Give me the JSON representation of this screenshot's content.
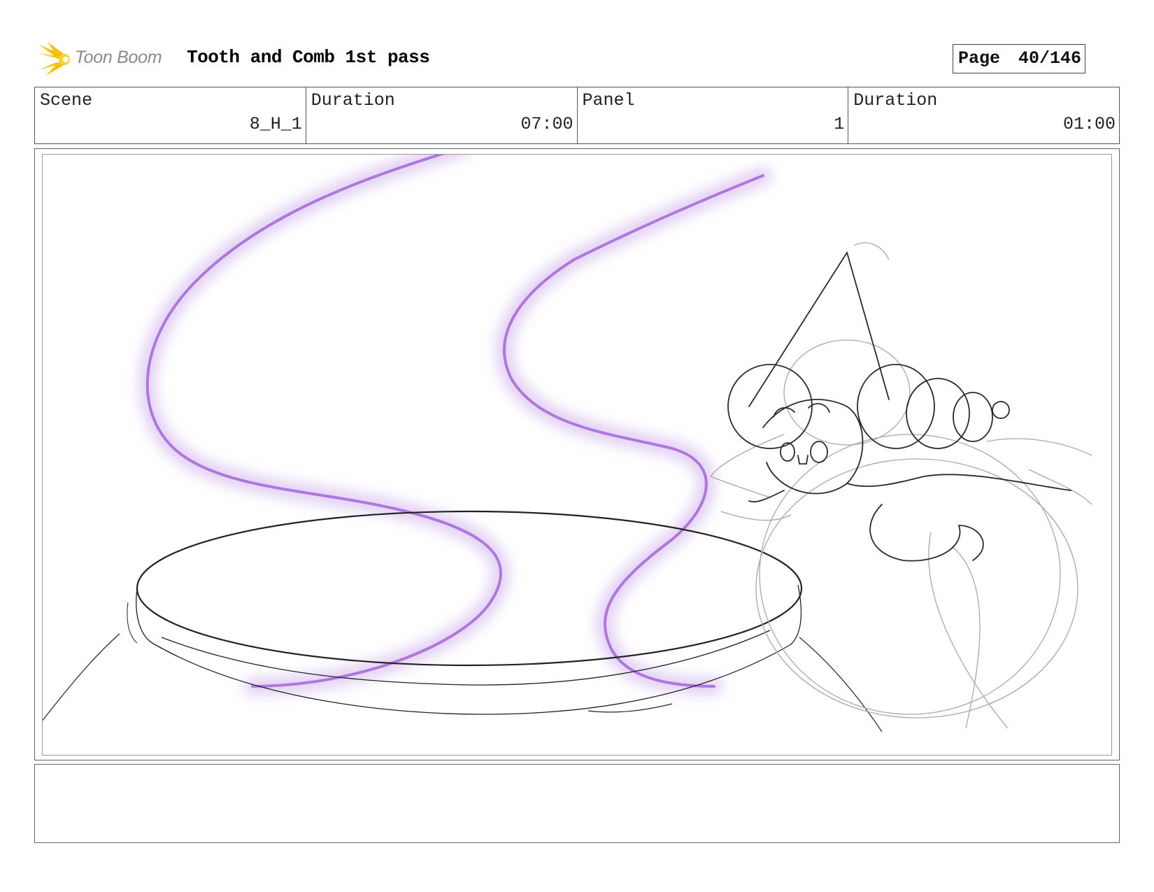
{
  "header": {
    "logo_text": "Toon Boom",
    "title": "Tooth and Comb 1st pass",
    "page_label": "Page",
    "page_number": "40/146"
  },
  "info": [
    {
      "label": "Scene",
      "value": "8_H_1"
    },
    {
      "label": "Duration",
      "value": "07:00"
    },
    {
      "label": "Panel",
      "value": "1"
    },
    {
      "label": "Duration",
      "value": "01:00"
    }
  ],
  "notes": {
    "text": ""
  },
  "colors": {
    "accent_logo": "#f4c20d",
    "smoke": "#b07be0",
    "sketch_dark": "#222222",
    "sketch_light": "#a8a8a8"
  }
}
